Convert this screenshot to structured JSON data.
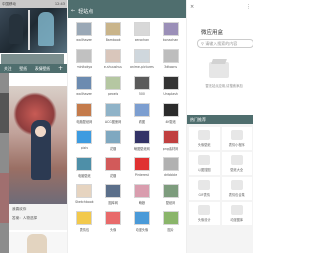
{
  "left": {
    "status_carrier": "中国移动",
    "status_time": "12:43",
    "tabs": [
      "关注",
      "壁纸",
      "表情壁纸"
    ],
    "info_lines": [
      "我喜欢你",
      "答案：人物选择"
    ]
  },
  "middle": {
    "title": "轻站点",
    "grid": [
      {
        "label": "wallhaven",
        "color": "#9aa8b6"
      },
      {
        "label": "Bambook",
        "color": "#c9b48a"
      },
      {
        "label": "zerochan",
        "color": "#d8d8d8"
      },
      {
        "label": "konachan",
        "color": "#9b8fb8"
      },
      {
        "label": "minitokyo",
        "color": "#c1c1c1"
      },
      {
        "label": "e-shuushuu",
        "color": "#d9c6bb"
      },
      {
        "label": "anime-pictures",
        "color": "#cfd7dd"
      },
      {
        "label": "3dtoons",
        "color": "#bdbdbd"
      },
      {
        "label": "wallhaven",
        "color": "#6c8bb0"
      },
      {
        "label": "pexels",
        "color": "#b5c7a2"
      },
      {
        "label": "500",
        "color": "#5a5a5a"
      },
      {
        "label": "Unsplash",
        "color": "#333333"
      },
      {
        "label": "电脑壁纸网",
        "color": "#c47b4b"
      },
      {
        "label": "ACG图册网",
        "color": "#8fb3c8"
      },
      {
        "label": "看图",
        "color": "#7c9ed0"
      },
      {
        "label": "4K壁纸",
        "color": "#2b2b2b"
      },
      {
        "label": "pixiv",
        "color": "#3d9be0"
      },
      {
        "label": "花瓣",
        "color": "#7fa8c0"
      },
      {
        "label": "萌图壁纸网",
        "color": "#333366"
      },
      {
        "label": "png素材网",
        "color": "#c04040"
      },
      {
        "label": "电脑壁纸",
        "color": "#4e8fa8"
      },
      {
        "label": "花瓣",
        "color": "#d25a5a"
      },
      {
        "label": "Pinterest",
        "color": "#e03232"
      },
      {
        "label": "dribbble",
        "color": "#b1b1b1"
      },
      {
        "label": "Sketchbook",
        "color": "#e6d4c0"
      },
      {
        "label": "图库网",
        "color": "#5b6f8a"
      },
      {
        "label": "萌娘",
        "color": "#d99dae"
      },
      {
        "label": "壁纸网",
        "color": "#7d9c7d"
      },
      {
        "label": "表情包",
        "color": "#f2c94c"
      },
      {
        "label": "头像",
        "color": "#e86a6a"
      },
      {
        "label": "动漫头像",
        "color": "#4a9ad8"
      },
      {
        "label": "图片",
        "color": "#8ab56a"
      }
    ]
  },
  "right": {
    "title": "微应用盒",
    "search_placeholder": "请输入搜索的内容",
    "hint": "暂无站点应用,请搜索添加",
    "section_title": "热门推荐",
    "items": [
      "头像壁纸",
      "表情小程序",
      "以图搜图",
      "壁纸大全",
      "GIF表情",
      "表情包合集",
      "头像设计",
      "动漫图库"
    ]
  }
}
